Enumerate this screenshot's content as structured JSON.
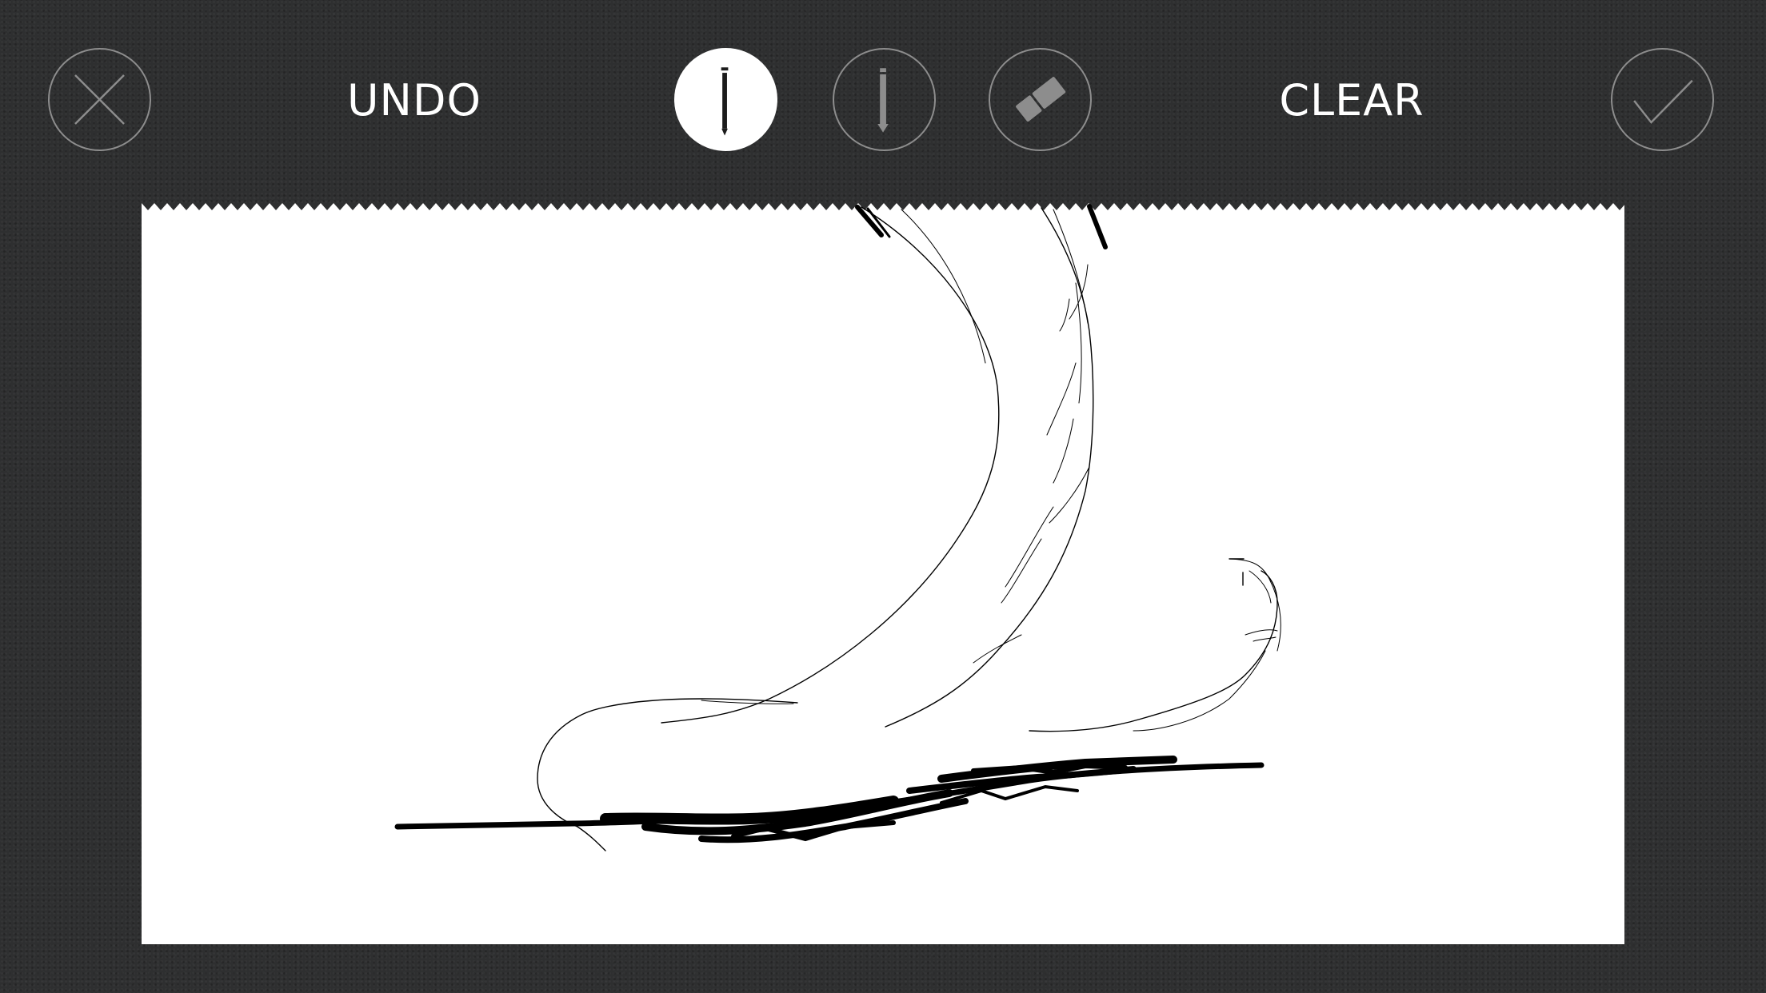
{
  "toolbar": {
    "undo_label": "UNDO",
    "clear_label": "CLEAR",
    "tools": [
      {
        "name": "pencil-icon",
        "selected": true
      },
      {
        "name": "pen-icon",
        "selected": false
      },
      {
        "name": "eraser-icon",
        "selected": false
      }
    ],
    "close_icon": "close-icon",
    "confirm_icon": "checkmark-icon"
  },
  "colors": {
    "background": "#2e2f30",
    "button_outline": "#8d8d8d",
    "selected_tool_fill": "#ffffff",
    "canvas": "#ffffff",
    "ink": "#000000"
  }
}
